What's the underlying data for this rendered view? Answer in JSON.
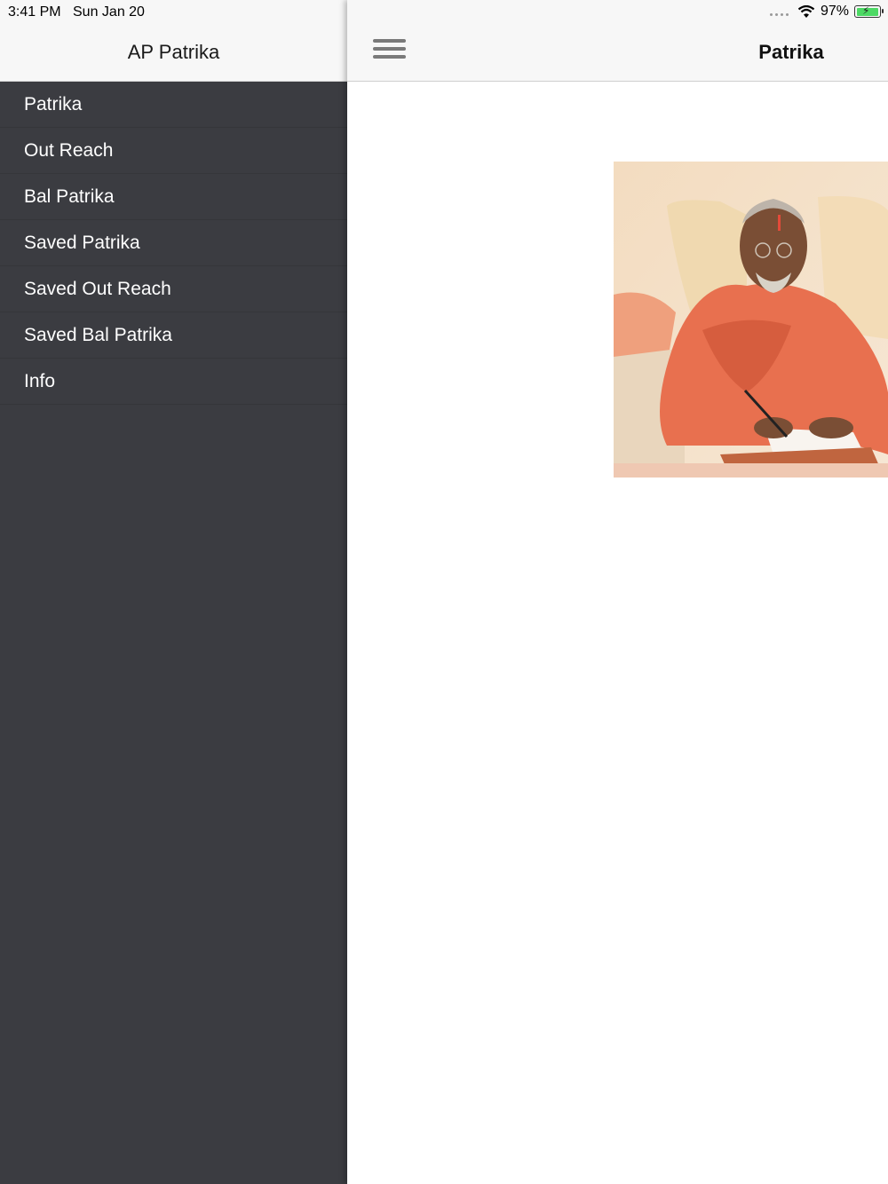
{
  "status_bar": {
    "time": "3:41 PM",
    "date": "Sun Jan 20",
    "battery_percent": "97%",
    "battery_level": 0.97,
    "wifi_icon": "wifi-icon",
    "battery_icon": "battery-charging-icon"
  },
  "drawer": {
    "title": "AP Patrika",
    "items": [
      {
        "label": "Patrika"
      },
      {
        "label": "Out Reach"
      },
      {
        "label": "Bal Patrika"
      },
      {
        "label": "Saved Patrika"
      },
      {
        "label": "Saved Out Reach"
      },
      {
        "label": "Saved Bal Patrika"
      },
      {
        "label": "Info"
      }
    ]
  },
  "main": {
    "title": "Patrika",
    "menu_icon": "hamburger-menu-icon",
    "hero_image": "photo of a monk in an orange robe writing a letter"
  },
  "colors": {
    "drawer_bg": "#3b3c41",
    "header_bg": "#f7f7f7",
    "robe_orange": "#e8704f",
    "battery_green": "#4cd964"
  }
}
